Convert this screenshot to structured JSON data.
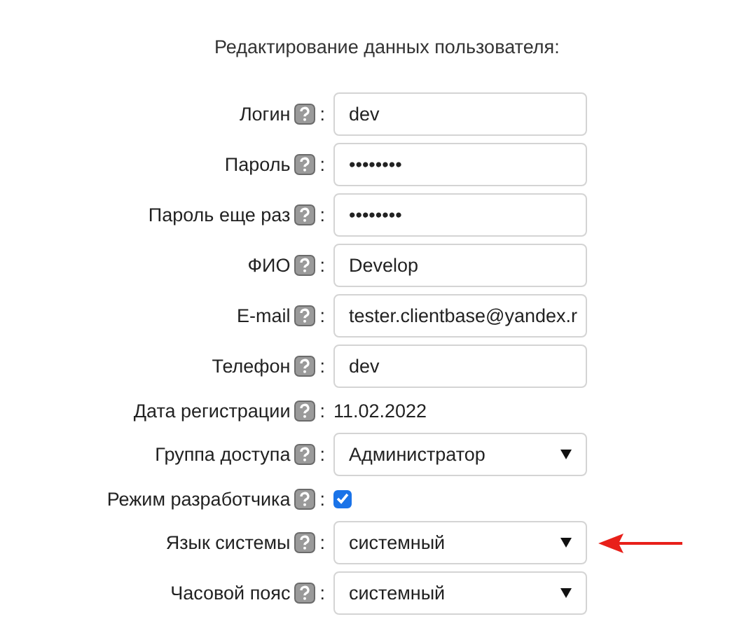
{
  "title": "Редактирование данных пользователя:",
  "rows": [
    {
      "label": "Логин",
      "colon": ":",
      "kind": "text",
      "value": "dev",
      "highlighted": false
    },
    {
      "label": "Пароль",
      "colon": ":",
      "kind": "password",
      "value": "••••••••",
      "highlighted": false
    },
    {
      "label": "Пароль еще раз",
      "colon": ":",
      "kind": "password",
      "value": "••••••••",
      "highlighted": false
    },
    {
      "label": "ФИО",
      "colon": ":",
      "kind": "text",
      "value": "Develop",
      "highlighted": false
    },
    {
      "label": "E-mail",
      "colon": ":",
      "kind": "text",
      "value": "tester.clientbase@yandex.r",
      "highlighted": false
    },
    {
      "label": "Телефон",
      "colon": ":",
      "kind": "text",
      "value": "dev",
      "highlighted": false
    },
    {
      "label": "Дата регистрации",
      "colon": ":",
      "kind": "static",
      "value": "11.02.2022",
      "highlighted": false
    },
    {
      "label": "Группа доступа",
      "colon": ":",
      "kind": "select",
      "value": "Администратор",
      "highlighted": false
    },
    {
      "label": "Режим разработчика",
      "colon": ":",
      "kind": "checkbox",
      "checked": true,
      "highlighted": false
    },
    {
      "label": "Язык системы",
      "colon": ":",
      "kind": "select",
      "value": "системный",
      "highlighted": true
    },
    {
      "label": "Часовой пояс",
      "colon": ":",
      "kind": "select",
      "value": "системный",
      "highlighted": false
    }
  ]
}
